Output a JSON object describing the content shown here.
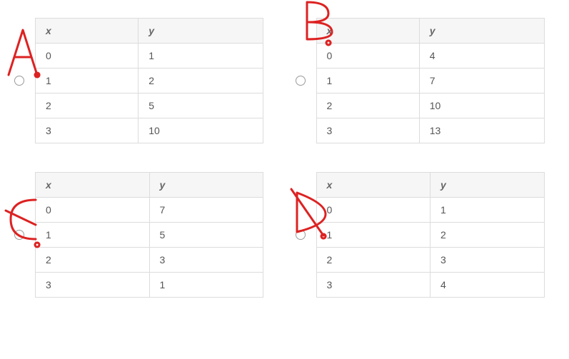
{
  "chart_data": [
    {
      "type": "table",
      "label": "A",
      "columns": [
        "x",
        "y"
      ],
      "rows": [
        [
          0,
          1
        ],
        [
          1,
          2
        ],
        [
          2,
          5
        ],
        [
          3,
          10
        ]
      ]
    },
    {
      "type": "table",
      "label": "B",
      "columns": [
        "x",
        "y"
      ],
      "rows": [
        [
          0,
          4
        ],
        [
          1,
          7
        ],
        [
          2,
          10
        ],
        [
          3,
          13
        ]
      ]
    },
    {
      "type": "table",
      "label": "C",
      "columns": [
        "x",
        "y"
      ],
      "rows": [
        [
          0,
          7
        ],
        [
          1,
          5
        ],
        [
          2,
          3
        ],
        [
          3,
          1
        ]
      ]
    },
    {
      "type": "table",
      "label": "D",
      "columns": [
        "x",
        "y"
      ],
      "rows": [
        [
          0,
          1
        ],
        [
          1,
          2
        ],
        [
          2,
          3
        ],
        [
          3,
          4
        ]
      ]
    }
  ]
}
